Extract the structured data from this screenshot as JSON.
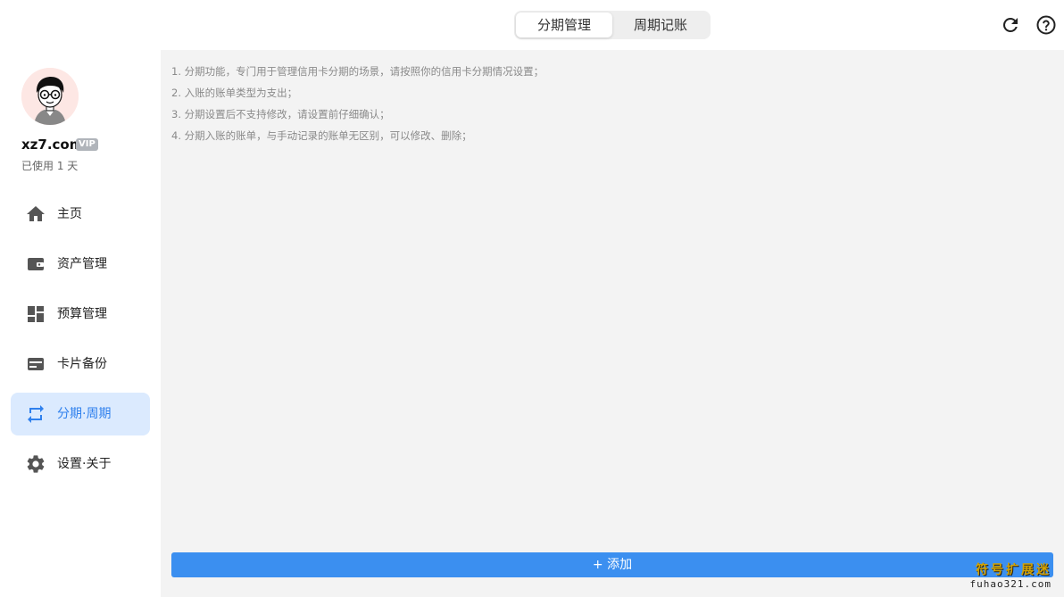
{
  "header": {
    "tabs": [
      {
        "label": "分期管理",
        "active": true
      },
      {
        "label": "周期记账",
        "active": false
      }
    ],
    "icons": [
      "refresh-icon",
      "help-icon"
    ]
  },
  "user": {
    "name": "xz7.com",
    "badge": "VIP",
    "usage": "已使用 1 天"
  },
  "sidebar": {
    "items": [
      {
        "label": "主页",
        "icon": "home-icon"
      },
      {
        "label": "资产管理",
        "icon": "wallet-icon"
      },
      {
        "label": "预算管理",
        "icon": "dashboard-icon"
      },
      {
        "label": "卡片备份",
        "icon": "card-icon"
      },
      {
        "label": "分期·周期",
        "icon": "repeat-icon",
        "active": true
      },
      {
        "label": "设置·关于",
        "icon": "gear-icon"
      }
    ]
  },
  "main": {
    "tips": [
      "1. 分期功能，专门用于管理信用卡分期的场景，请按照你的信用卡分期情况设置；",
      "2. 入账的账单类型为支出；",
      "3. 分期设置后不支持修改，请设置前仔细确认；",
      "4. 分期入账的账单，与手动记录的账单无区别，可以修改、删除；"
    ],
    "add_label": "+ 添加"
  },
  "watermark": {
    "line1": "符号扩展迷",
    "line2": "fuhao321.com"
  },
  "colors": {
    "accent": "#3b8ff0",
    "active_bg": "#dbeafe",
    "active_text": "#2f80ed",
    "main_bg": "#f3f3f3"
  }
}
